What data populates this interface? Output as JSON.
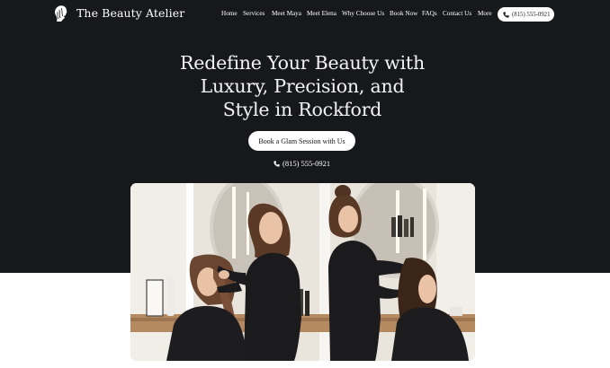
{
  "brand": {
    "name": "The Beauty Atelier",
    "logo_icon": "woman-profile-logo-icon"
  },
  "nav": {
    "items": [
      {
        "label": "Home"
      },
      {
        "label": "Services"
      },
      {
        "label": "Meet Maya"
      },
      {
        "label": "Meet Elena"
      },
      {
        "label": "Why Choose Us"
      },
      {
        "label": "Book Now"
      },
      {
        "label": "FAQs"
      },
      {
        "label": "Contact Us"
      },
      {
        "label": "More"
      }
    ],
    "phone": "(815) 555-0921",
    "phone_icon": "phone-icon"
  },
  "hero": {
    "title_lines": [
      "Redefine Your Beauty with",
      "Luxury, Precision, and",
      "Style in Rockford"
    ],
    "cta_label": "Book a Glam Session with Us",
    "phone": "(815) 555-0921",
    "phone_icon": "phone-icon",
    "image": "photo of two stylists styling clients' hair in a salon"
  },
  "colors": {
    "hero_background": "#17181b",
    "page_background": "#ffffff",
    "text_light": "#ffffff"
  }
}
